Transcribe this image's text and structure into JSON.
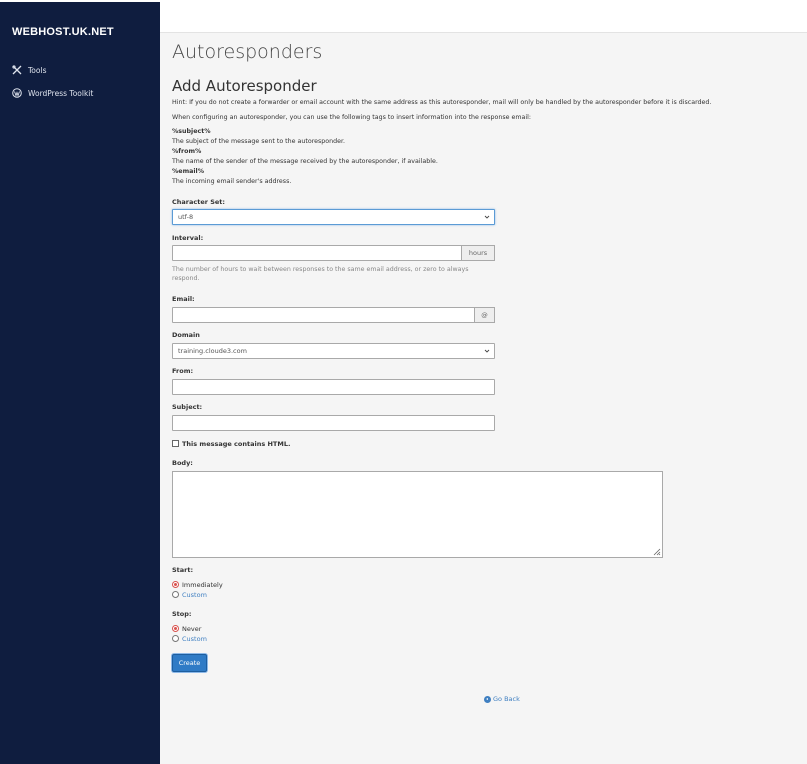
{
  "sidebar": {
    "brand": "WEBHOST.UK.NET",
    "items": [
      {
        "label": "Tools",
        "icon": "tools-icon"
      },
      {
        "label": "WordPress Toolkit",
        "icon": "wordpress-icon"
      }
    ]
  },
  "page": {
    "title": "Autoresponders",
    "section_title": "Add Autoresponder",
    "hint": "Hint: If you do not create a forwarder or email account with the same address as this autoresponder, mail will only be handled by the autoresponder before it is discarded.",
    "tags_intro": "When configuring an autoresponder, you can use the following tags to insert information into the response email:",
    "tags": [
      {
        "tag": "%subject%",
        "desc": "The subject of the message sent to the autoresponder."
      },
      {
        "tag": "%from%",
        "desc": "The name of the sender of the message received by the autoresponder, if available."
      },
      {
        "tag": "%email%",
        "desc": "The incoming email sender's address."
      }
    ]
  },
  "form": {
    "charset": {
      "label": "Character Set:",
      "value": "utf-8"
    },
    "interval": {
      "label": "Interval:",
      "value": "",
      "addon": "hours",
      "help": "The number of hours to wait between responses to the same email address, or zero to always respond."
    },
    "email": {
      "label": "Email:",
      "value": "",
      "addon": "@"
    },
    "domain": {
      "label": "Domain",
      "value": "training.cloude3.com"
    },
    "from": {
      "label": "From:",
      "value": ""
    },
    "subject": {
      "label": "Subject:",
      "value": ""
    },
    "html_checkbox": {
      "label": "This message contains HTML.",
      "checked": false
    },
    "body": {
      "label": "Body:",
      "value": ""
    },
    "start": {
      "label": "Start:",
      "options": [
        "Immediately",
        "Custom"
      ],
      "selected": "Immediately"
    },
    "stop": {
      "label": "Stop:",
      "options": [
        "Never",
        "Custom"
      ],
      "selected": "Never"
    },
    "create_label": "Create",
    "go_back_label": "Go Back"
  },
  "colors": {
    "sidebar_bg": "#0f1d3f",
    "accent": "#2f7bc6",
    "radio_selected": "#d9534f",
    "link": "#3f7fc1"
  }
}
